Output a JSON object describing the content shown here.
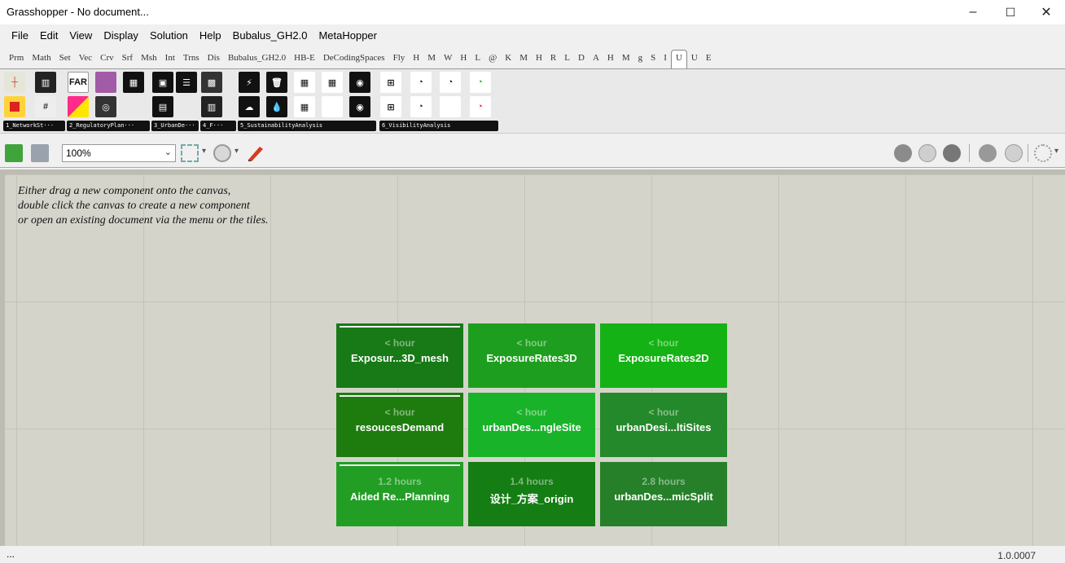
{
  "window": {
    "title": "Grasshopper - No document...",
    "min": "–",
    "max": "☐",
    "close": "✕"
  },
  "menu": [
    "File",
    "Edit",
    "View",
    "Display",
    "Solution",
    "Help",
    "Bubalus_GH2.0",
    "MetaHopper"
  ],
  "tabs": [
    "Prm",
    "Math",
    "Set",
    "Vec",
    "Crv",
    "Srf",
    "Msh",
    "Int",
    "Trns",
    "Dis",
    "Bubalus_GH2.0",
    "HB-E",
    "DeCodingSpaces",
    "Fly",
    "H",
    "M",
    "W",
    "H",
    "L",
    "@",
    "K",
    "M",
    "H",
    "R",
    "L",
    "D",
    "A",
    "H",
    "M",
    "g",
    "S",
    "I",
    "U",
    "U",
    "E"
  ],
  "active_tab_index": 32,
  "ribbon_groups": [
    {
      "label": "1_NetworkSt···"
    },
    {
      "label": "2_RegulatoryPlan···"
    },
    {
      "label": "3_UrbanDe···"
    },
    {
      "label": "4_F···"
    },
    {
      "label": "5_SustainabilityAnalysis"
    },
    {
      "label": "6_VisibilityAnalysis"
    }
  ],
  "ribbon_icon_text": {
    "far": "FAR"
  },
  "toolbar": {
    "zoom": "100%"
  },
  "hint": [
    "Either drag a new component onto the canvas,",
    "double click the canvas to create a new component",
    "or open an existing document via the menu or the tiles."
  ],
  "tiles": [
    {
      "time": "< hour",
      "name": "Exposur...3D_mesh",
      "color": "#177a16"
    },
    {
      "time": "< hour",
      "name": "ExposureRates3D",
      "color": "#1e9e1e"
    },
    {
      "time": "< hour",
      "name": "ExposureRates2D",
      "color": "#14b214"
    },
    {
      "time": "< hour",
      "name": "resoucesDemand",
      "color": "#1e7c0f"
    },
    {
      "time": "< hour",
      "name": "urbanDes...ngleSite",
      "color": "#19b329"
    },
    {
      "time": "< hour",
      "name": "urbanDesi...ltiSites",
      "color": "#24892a"
    },
    {
      "time": "1.2 hours",
      "name": "Aided Re...Planning",
      "color": "#229e25"
    },
    {
      "time": "1.4 hours",
      "name": "设计_方案_origin",
      "color": "#147d13"
    },
    {
      "time": "2.8 hours",
      "name": "urbanDes...micSplit",
      "color": "#268029"
    }
  ],
  "status": {
    "left": "...",
    "version": "1.0.0007"
  }
}
